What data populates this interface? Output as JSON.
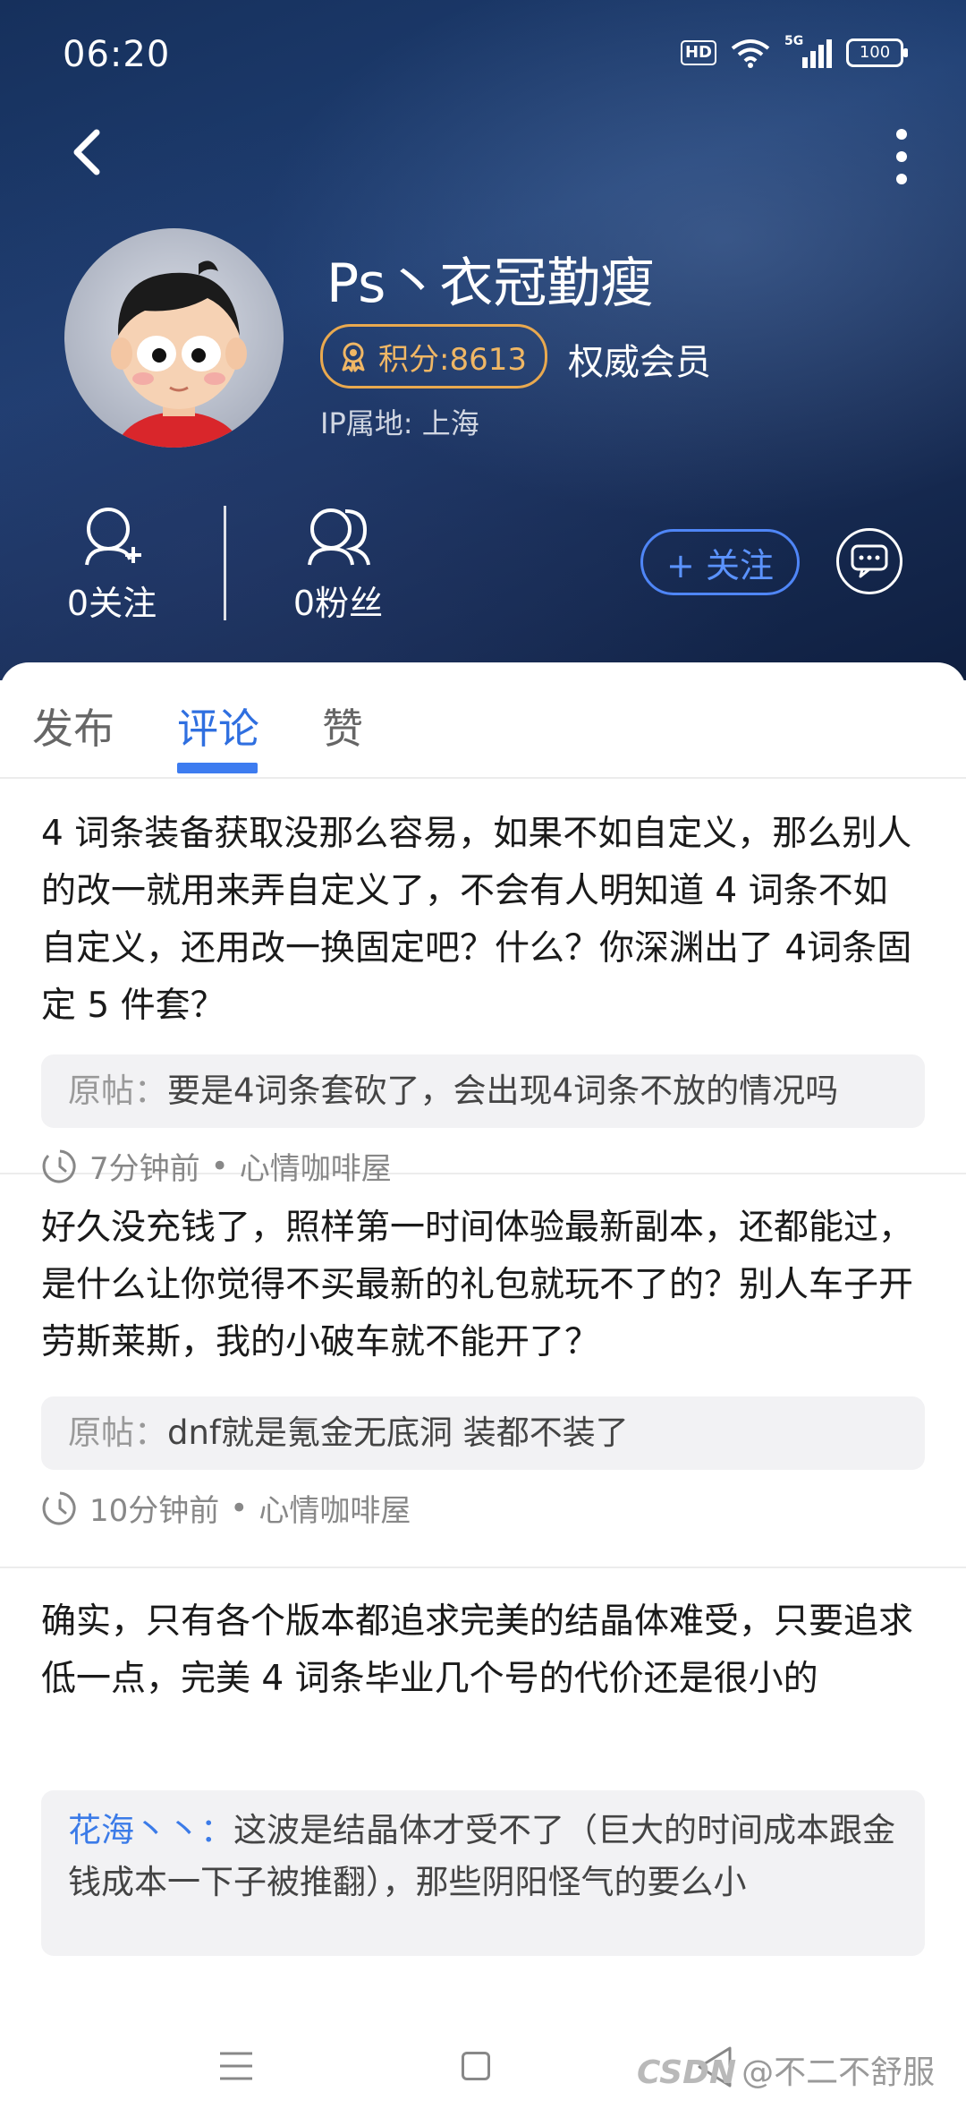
{
  "status_bar": {
    "time": "06:20",
    "hd": "HD",
    "signal": "5G",
    "battery": "100"
  },
  "profile": {
    "name": "Ps丶衣冠勤瘦",
    "score": "积分:8613",
    "member": "权威会员",
    "ip": "IP属地: 上海",
    "following": "0关注",
    "followers": "0粉丝",
    "follow_button": "+ 关注"
  },
  "tabs": [
    "发布",
    "评论",
    "赞"
  ],
  "active_tab": "评论",
  "posts": [
    {
      "text": "4 词条装备获取没那么容易，如果不如自定义，那么别人的改一就用来弄自定义了，不会有人明知道 4 词条不如自定义，还用改一换固定吧？什么？你深渊出了 4词条固定 5 件套？",
      "quote_label": "原帖：",
      "quote": "要是4词条套砍了，会出现4词条不放的情况吗",
      "time": "7分钟前",
      "board": "心情咖啡屋"
    },
    {
      "text": "好久没充钱了，照样第一时间体验最新副本，还都能过，是什么让你觉得不买最新的礼包就玩不了的？别人车子开劳斯莱斯，我的小破车就不能开了？",
      "quote_label": "原帖：",
      "quote": "dnf就是氪金无底洞 装都不装了",
      "time": "10分钟前",
      "board": "心情咖啡屋"
    },
    {
      "text": "确实，只有各个版本都追求完美的结晶体难受，只要追求低一点，完美 4 词条毕业几个号的代价还是很小的",
      "reply_user": "花海丶丶：",
      "reply": "这波是结晶体才受不了（巨大的时间成本跟金钱成本一下子被推翻），那些阴阳怪气的要么小"
    }
  ],
  "dot": "•",
  "watermark": {
    "logo": "CSDN",
    "text": "@不二不舒服"
  }
}
